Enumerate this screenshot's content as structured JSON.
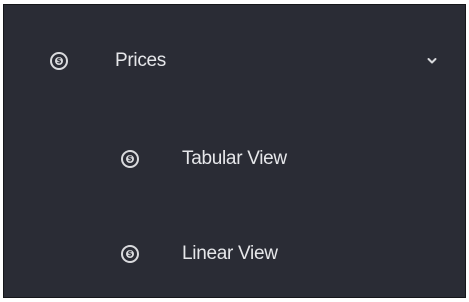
{
  "menu": {
    "parent": {
      "label": "Prices",
      "icon": "dollar-circle-icon",
      "expanded": true,
      "toggle_icon": "chevron-down-icon"
    },
    "children": [
      {
        "label": "Tabular View",
        "icon": "dollar-circle-icon"
      },
      {
        "label": "Linear View",
        "icon": "dollar-circle-icon"
      }
    ]
  },
  "colors": {
    "panel_background": "#2a2c35",
    "text": "#e6e7ea",
    "icon": "#d9dadd"
  }
}
